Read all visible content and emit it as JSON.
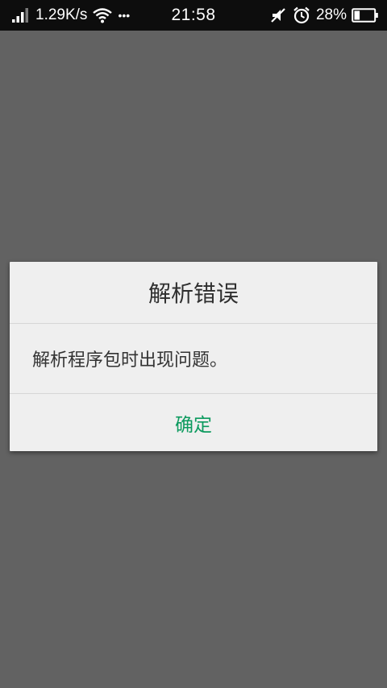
{
  "status_bar": {
    "network_speed": "1.29K/s",
    "more_indicator": "•••",
    "time": "21:58",
    "battery_percent": "28%",
    "battery_level": 0.28,
    "icons": [
      "signal-icon",
      "wifi-icon",
      "vibrate-off-icon",
      "alarm-icon",
      "battery-icon"
    ]
  },
  "dialog": {
    "title": "解析错误",
    "message": "解析程序包时出现问题。",
    "confirm_label": "确定",
    "accent_color": "#0c9a5e"
  }
}
